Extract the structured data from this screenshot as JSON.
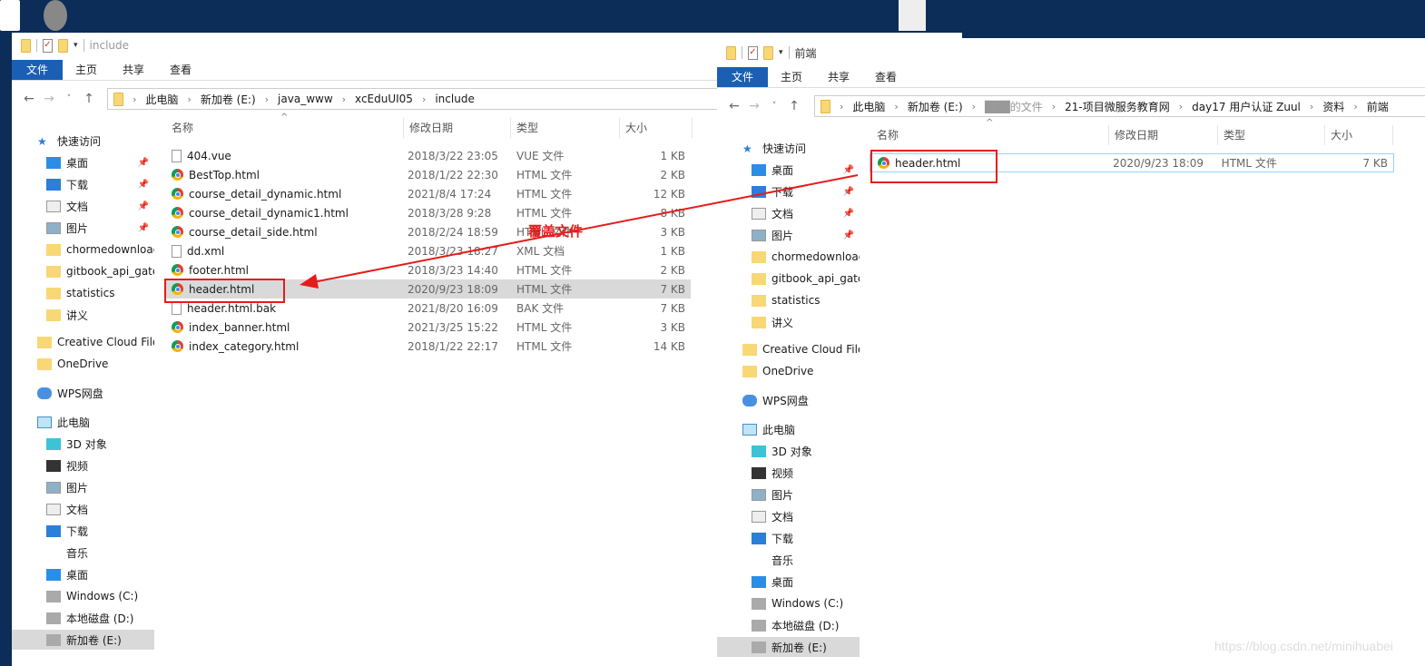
{
  "desktop": {
    "watermark": "https://blog.csdn.net/minihuabei"
  },
  "annotation": {
    "label": "覆盖文件",
    "color": "#e51c1c"
  },
  "ribbon_tabs": [
    "文件",
    "主页",
    "共享",
    "查看"
  ],
  "columns": [
    "名称",
    "修改日期",
    "类型",
    "大小"
  ],
  "sidebar": {
    "quick": "快速访问",
    "pinned": [
      "桌面",
      "下载",
      "文档",
      "图片"
    ],
    "folders": [
      "chormedownload",
      "gitbook_api_gateway",
      "statistics",
      "讲义"
    ],
    "cc": "Creative Cloud Files",
    "onedrive": "OneDrive",
    "wps": "WPS网盘",
    "pc": "此电脑",
    "pc_items": [
      "3D 对象",
      "视频",
      "图片",
      "文档",
      "下载",
      "音乐",
      "桌面",
      "Windows (C:)",
      "本地磁盘 (D:)",
      "新加卷 (E:)"
    ]
  },
  "left": {
    "title": "include",
    "breadcrumb": [
      "此电脑",
      "新加卷 (E:)",
      "java_www",
      "xcEduUI05",
      "include"
    ],
    "files": [
      {
        "name": "404.vue",
        "date": "2018/3/22 23:05",
        "type": "VUE 文件",
        "size": "1 KB",
        "icon": "file"
      },
      {
        "name": "BestTop.html",
        "date": "2018/1/22 22:30",
        "type": "HTML 文件",
        "size": "2 KB",
        "icon": "chrome"
      },
      {
        "name": "course_detail_dynamic.html",
        "date": "2021/8/4 17:24",
        "type": "HTML 文件",
        "size": "12 KB",
        "icon": "chrome"
      },
      {
        "name": "course_detail_dynamic1.html",
        "date": "2018/3/28 9:28",
        "type": "HTML 文件",
        "size": "8 KB",
        "icon": "chrome"
      },
      {
        "name": "course_detail_side.html",
        "date": "2018/2/24 18:59",
        "type": "HTML 文件",
        "size": "3 KB",
        "icon": "chrome"
      },
      {
        "name": "dd.xml",
        "date": "2018/3/23 18:27",
        "type": "XML 文档",
        "size": "1 KB",
        "icon": "file"
      },
      {
        "name": "footer.html",
        "date": "2018/3/23 14:40",
        "type": "HTML 文件",
        "size": "2 KB",
        "icon": "chrome"
      },
      {
        "name": "header.html",
        "date": "2020/9/23 18:09",
        "type": "HTML 文件",
        "size": "7 KB",
        "icon": "chrome",
        "selected": true
      },
      {
        "name": "header.html.bak",
        "date": "2021/8/20 16:09",
        "type": "BAK 文件",
        "size": "7 KB",
        "icon": "file"
      },
      {
        "name": "index_banner.html",
        "date": "2021/3/25 15:22",
        "type": "HTML 文件",
        "size": "3 KB",
        "icon": "chrome"
      },
      {
        "name": "index_category.html",
        "date": "2018/1/22 22:17",
        "type": "HTML 文件",
        "size": "14 KB",
        "icon": "chrome"
      }
    ]
  },
  "right": {
    "title": "前端",
    "breadcrumb": [
      "此电脑",
      "新加卷 (E:)",
      "███的文件",
      "21-项目微服务教育网",
      "day17 用户认证 Zuul",
      "资料",
      "前端"
    ],
    "files": [
      {
        "name": "header.html",
        "date": "2020/9/23 18:09",
        "type": "HTML 文件",
        "size": "7 KB",
        "icon": "chrome"
      }
    ]
  }
}
